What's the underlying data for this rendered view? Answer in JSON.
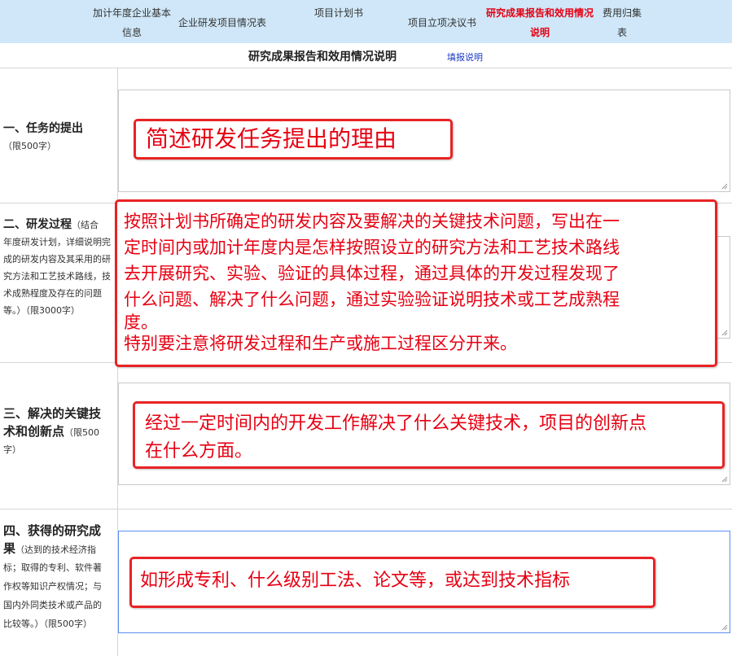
{
  "tabs": [
    {
      "line1": "加计年度企业基本",
      "line2": "信息"
    },
    {
      "line1": "企业研发项目情况表",
      "line2": ""
    },
    {
      "line1": "项目计划书",
      "line2": ""
    },
    {
      "line1": "项目立项决议书",
      "line2": ""
    },
    {
      "line1": "研究成果报告和效用情况",
      "line2": "说明"
    },
    {
      "line1": "费用归集",
      "line2": "表"
    }
  ],
  "section": {
    "title": "研究成果报告和效用情况说明",
    "help_link": "填报说明"
  },
  "rows": [
    {
      "label_main": "一、任务的提出",
      "label_note": "（限500字）",
      "annotation": "简述研发任务提出的理由"
    },
    {
      "label_main": "二、研发过程",
      "label_note_a": "（结合",
      "label_note": "年度研发计划，详细说明完成的研发内容及其采用的研究方法和工艺技术路线，技术成熟程度及存在的问题等。）（限3000字）",
      "annotation_lines": [
        "按照计划书所确定的研发内容及要解决的关键技术问题，写出在一",
        "定时间内或加计年度内是怎样按照设立的研究方法和工艺技术路线",
        "去开展研究、实验、验证的具体过程，通过具体的开发过程发现了",
        "什么问题、解决了什么问题，通过实验验证说明技术或工艺成熟程",
        "度。",
        "特别要注意将研发过程和生产或施工过程区分开来。"
      ]
    },
    {
      "label_main_1": "三、解决的关键技",
      "label_main_2": "术和创新点",
      "label_note_a": "（限500",
      "label_note": "字）",
      "annotation_lines": [
        "经过一定时间内的开发工作解决了什么关键技术，项目的创新点",
        "在什么方面。"
      ]
    },
    {
      "label_main_1": "四、获得的研究成",
      "label_main_2": "果",
      "label_note_a": "（达到的技术经济指",
      "label_note_lines": [
        "标；取得的专利、软件著",
        "作权等知识产权情况；与",
        "国内外同类技术或产品的",
        "比较等。）（限500字）"
      ],
      "annotation": "如形成专利、什么级别工法、论文等，或达到技术指标"
    }
  ],
  "colors": {
    "tab_bg": "#cfe7f8",
    "active_tab": "#e60012",
    "annotation_border": "#e82325",
    "link": "#1a39c4"
  }
}
